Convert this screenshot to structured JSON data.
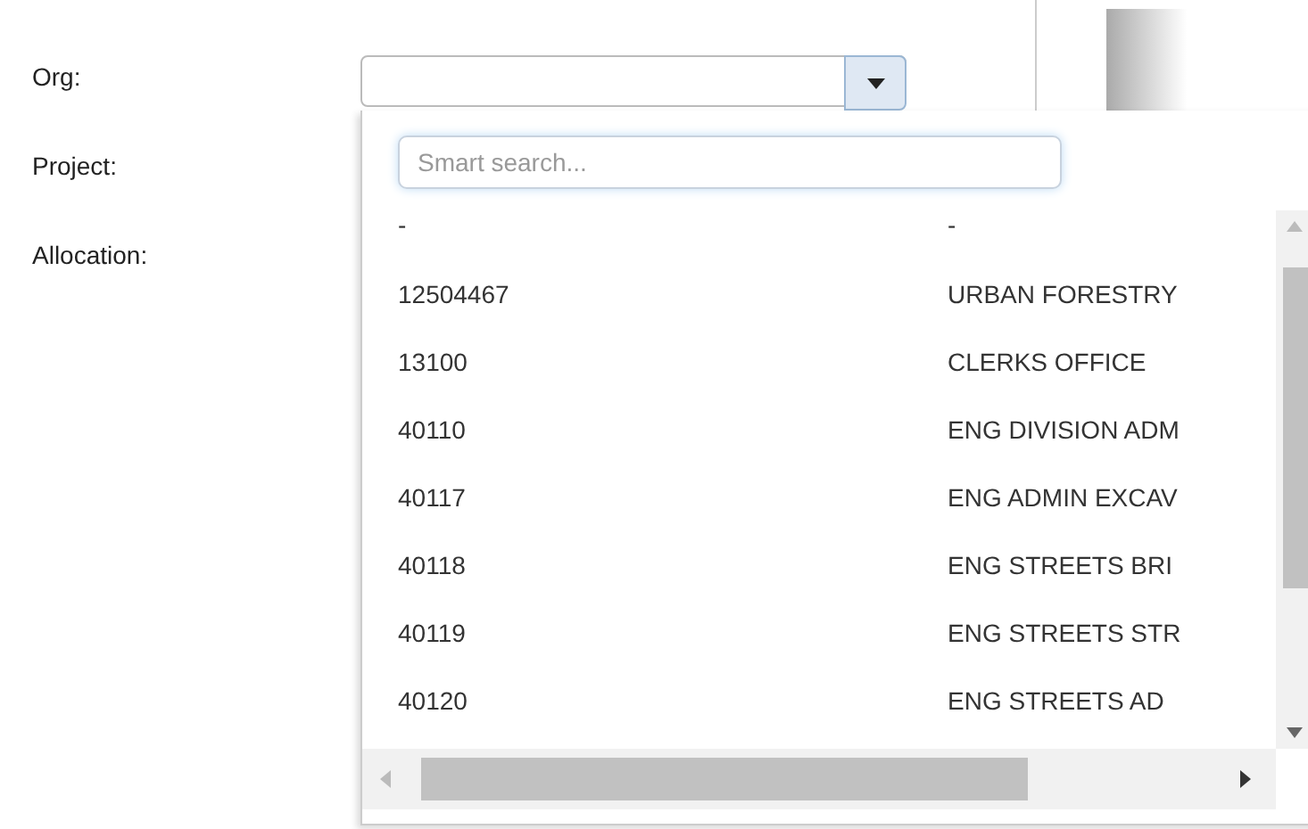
{
  "form": {
    "fields": [
      {
        "label": "Org:"
      },
      {
        "label": "Project:"
      },
      {
        "label": "Allocation:"
      }
    ]
  },
  "dropdown": {
    "search": {
      "placeholder": "Smart search..."
    },
    "rows": [
      {
        "code": "-",
        "name": "-"
      },
      {
        "code": "12504467",
        "name": "URBAN FORESTRY"
      },
      {
        "code": "13100",
        "name": "CLERKS OFFICE"
      },
      {
        "code": "40110",
        "name": "ENG DIVISION ADM"
      },
      {
        "code": "40117",
        "name": "ENG ADMIN EXCAV"
      },
      {
        "code": "40118",
        "name": "ENG STREETS BRI"
      },
      {
        "code": "40119",
        "name": "ENG STREETS STR"
      },
      {
        "code": "40120",
        "name": "ENG STREETS AD"
      }
    ]
  }
}
